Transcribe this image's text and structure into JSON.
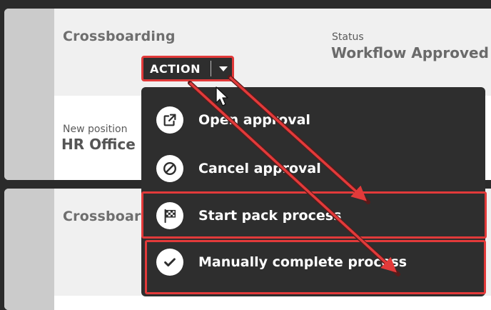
{
  "card1": {
    "title": "Crossboarding",
    "status_label": "Status",
    "status_value": "Workflow Approved",
    "new_position_label": "New position",
    "new_position_value": "HR Office"
  },
  "card2": {
    "title": "Crossboarding"
  },
  "action_button": {
    "label": "ACTION",
    "caret_icon": "caret-down-icon"
  },
  "menu": {
    "items": [
      {
        "label": "Open approval",
        "icon": "external-link-icon"
      },
      {
        "label": "Cancel approval",
        "icon": "cancel-icon"
      },
      {
        "label": "Start pack process",
        "icon": "checkered-flag-icon"
      },
      {
        "label": "Manually complete process",
        "icon": "checkmark-icon"
      }
    ]
  },
  "annotation": {
    "color": "#e23a3a",
    "highlighted_items": [
      "Start pack process",
      "Manually complete process"
    ]
  }
}
